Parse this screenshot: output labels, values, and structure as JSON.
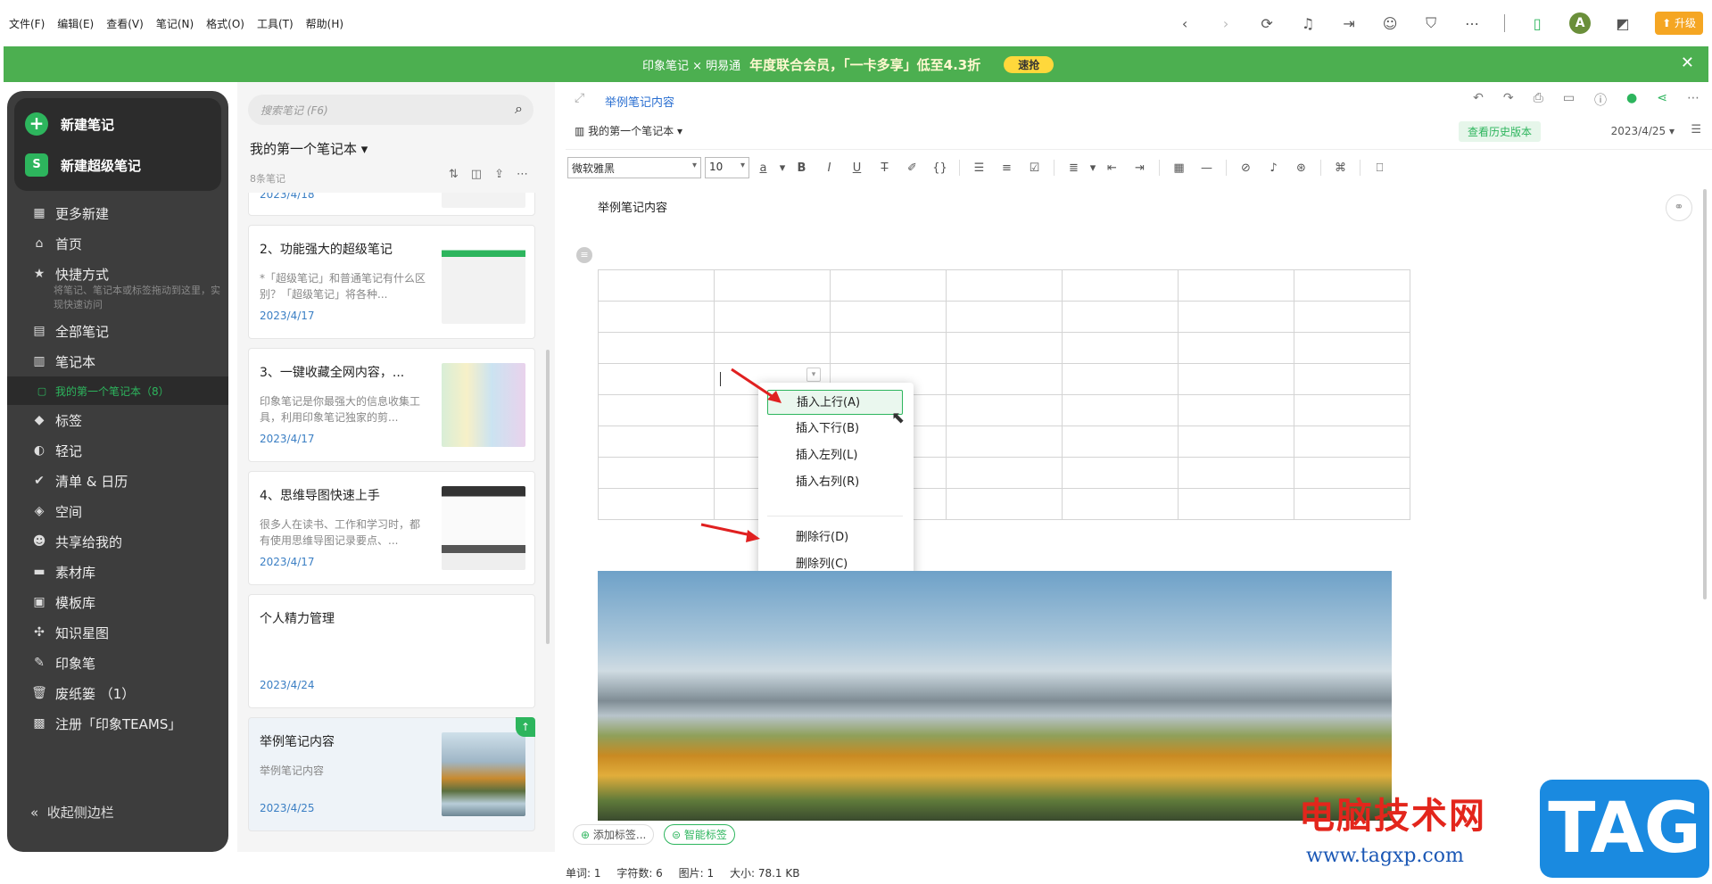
{
  "menubar": {
    "items": [
      "文件(F)",
      "编辑(E)",
      "查看(V)",
      "笔记(N)",
      "格式(O)",
      "工具(T)",
      "帮助(H)"
    ],
    "avatar_letter": "A",
    "upgrade_label": "升级"
  },
  "banner": {
    "brand": "印象笔记 × 明易通",
    "text": "年度联合会员，「一卡多享」低至4.3折",
    "button": "速抢"
  },
  "sidebar": {
    "new_note": "新建笔记",
    "new_super_note": "新建超级笔记",
    "more_new": "更多新建",
    "home": "首页",
    "shortcuts": "快捷方式",
    "shortcuts_hint": "将笔记、笔记本或标签拖动到这里，实现快速访问",
    "all_notes": "全部笔记",
    "notebooks": "笔记本",
    "active_notebook": "我的第一个笔记本（8）",
    "tags": "标签",
    "light_notes": "轻记",
    "todo_calendar": "清单 & 日历",
    "space": "空间",
    "shared": "共享给我的",
    "materials": "素材库",
    "templates": "模板库",
    "knowledge_map": "知识星图",
    "pen": "印象笔",
    "trash": "废纸篓 （1）",
    "teams": "注册「印象TEAMS」",
    "collapse": "收起侧边栏"
  },
  "notelist": {
    "search_placeholder": "搜索笔记 (F6)",
    "notebook_title": "我的第一个笔记本",
    "count": "8条笔记",
    "cards": [
      {
        "title": "",
        "snippet": "",
        "date": "2023/4/18"
      },
      {
        "title": "2、功能强大的超级笔记",
        "snippet": "*「超级笔记」和普通笔记有什么区别？「超级笔记」将各种...",
        "date": "2023/4/17"
      },
      {
        "title": "3、一键收藏全网内容，...",
        "snippet": "印象笔记是你最强大的信息收集工具，利用印象笔记独家的剪...",
        "date": "2023/4/17"
      },
      {
        "title": "4、思维导图快速上手",
        "snippet": "很多人在读书、工作和学习时，都有使用思维导图记录要点、...",
        "date": "2023/4/17"
      },
      {
        "title": "个人精力管理",
        "snippet": "",
        "date": "2023/4/24"
      },
      {
        "title": "举例笔记内容",
        "snippet": "举例笔记内容",
        "date": "2023/4/25"
      }
    ]
  },
  "editor": {
    "title": "举例笔记内容",
    "notebook": "我的第一个笔记本",
    "history_button": "查看历史版本",
    "date": "2023/4/25",
    "font_family": "微软雅黑",
    "font_size": "10",
    "content_title": "举例笔记内容",
    "context_menu": [
      "插入上行(A)",
      "插入下行(B)",
      "插入左列(L)",
      "插入右列(R)",
      "删除行(D)",
      "删除列(C)"
    ],
    "add_tag": "添加标签...",
    "smart_tag": "智能标签"
  },
  "status": {
    "words": "单词: 1",
    "chars": "字符数: 6",
    "images": "图片: 1",
    "size": "大小: 78.1 KB"
  },
  "watermark": {
    "site_name": "电脑技术网",
    "url": "www.tagxp.com",
    "tag": "TAG"
  },
  "colors": {
    "accent": "#2db55d",
    "sidebar_bg": "#3d3d3d",
    "banner_bg": "#4caf50",
    "link": "#2a6fd1"
  }
}
